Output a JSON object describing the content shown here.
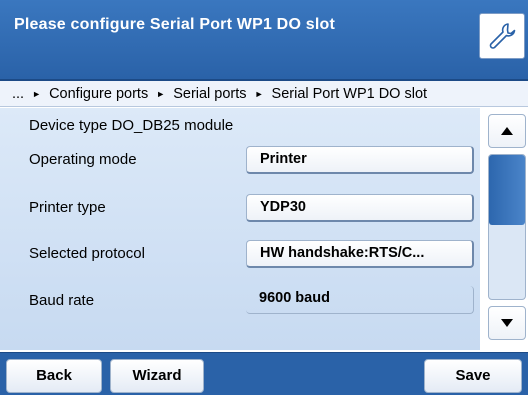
{
  "header": {
    "title": "Please configure Serial Port WP1 DO slot",
    "settings_icon": "wrench-icon"
  },
  "breadcrumb": {
    "ellipsis": "...",
    "items": [
      "Configure ports",
      "Serial ports",
      "Serial Port WP1 DO slot"
    ]
  },
  "content": {
    "device_type": "Device type DO_DB25 module",
    "rows": [
      {
        "label": "Operating mode",
        "value": "Printer"
      },
      {
        "label": "Printer type",
        "value": "YDP30"
      },
      {
        "label": "Selected protocol",
        "value": "HW handshake:RTS/C..."
      },
      {
        "label": "Baud rate",
        "value": "9600 baud"
      }
    ]
  },
  "scrollbar": {
    "up_icon": "triangle-up-icon",
    "down_icon": "triangle-down-icon"
  },
  "footer": {
    "back_label": "Back",
    "wizard_label": "Wizard",
    "save_label": "Save"
  }
}
